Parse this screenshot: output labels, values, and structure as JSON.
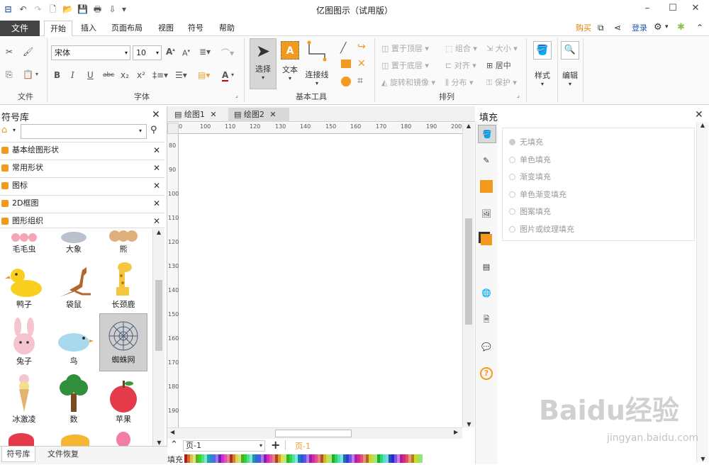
{
  "app": {
    "title": "亿图图示（试用版）"
  },
  "menu": {
    "file": "文件",
    "tabs": [
      "开始",
      "插入",
      "页面布局",
      "视图",
      "符号",
      "帮助"
    ],
    "buy": "购买",
    "login": "登录"
  },
  "ribbon": {
    "font_name": "宋体",
    "font_size": "10",
    "groups": {
      "file": "文件",
      "font": "字体",
      "basic_tools": "基本工具",
      "arrange": "排列"
    },
    "tools": {
      "select": "选择",
      "text": "文本",
      "connector": "连接线"
    },
    "arrange": {
      "bring_top": "置于顶层",
      "send_bottom": "置于底层",
      "rotate": "旋转和镜像",
      "group": "组合",
      "align": "对齐",
      "distribute": "分布",
      "size": "大小",
      "center": "居中",
      "protect": "保护"
    },
    "style": "样式",
    "edit": "编辑"
  },
  "library": {
    "title": "符号库",
    "search_value": "",
    "items": [
      "基本绘图形状",
      "常用形状",
      "图标",
      "2D框图",
      "图形组织"
    ]
  },
  "symbols": {
    "row0": [
      "毛毛虫",
      "大象",
      "熊"
    ],
    "row1": [
      "鸭子",
      "袋鼠",
      "长颈鹿"
    ],
    "row2": [
      "兔子",
      "鸟",
      "蜘蛛网"
    ],
    "row3": [
      "冰激凌",
      "数",
      "苹果"
    ]
  },
  "bottom_tabs": {
    "symbols": "符号库",
    "recovery": "文件恢复"
  },
  "doc_tabs": [
    "绘图1",
    "绘图2"
  ],
  "ruler": {
    "h": [
      "0",
      "100",
      "110",
      "120",
      "130",
      "140",
      "150",
      "160",
      "170",
      "180",
      "190",
      "200"
    ],
    "v": [
      "80",
      "90",
      "100",
      "110",
      "120",
      "130",
      "140",
      "150",
      "160",
      "170",
      "180",
      "190"
    ]
  },
  "page": {
    "name": "页-1",
    "current": "页-1"
  },
  "fill_footer": "填充",
  "fill": {
    "title": "填充",
    "options": [
      "无填充",
      "单色填充",
      "渐变填充",
      "单色渐变填充",
      "图案填充",
      "图片或纹理填充"
    ]
  },
  "colors": {
    "accent": "#f39a1e",
    "filetab": "#444444"
  },
  "watermark": {
    "brand": "Baidu经验",
    "url": "jingyan.baidu.com"
  }
}
